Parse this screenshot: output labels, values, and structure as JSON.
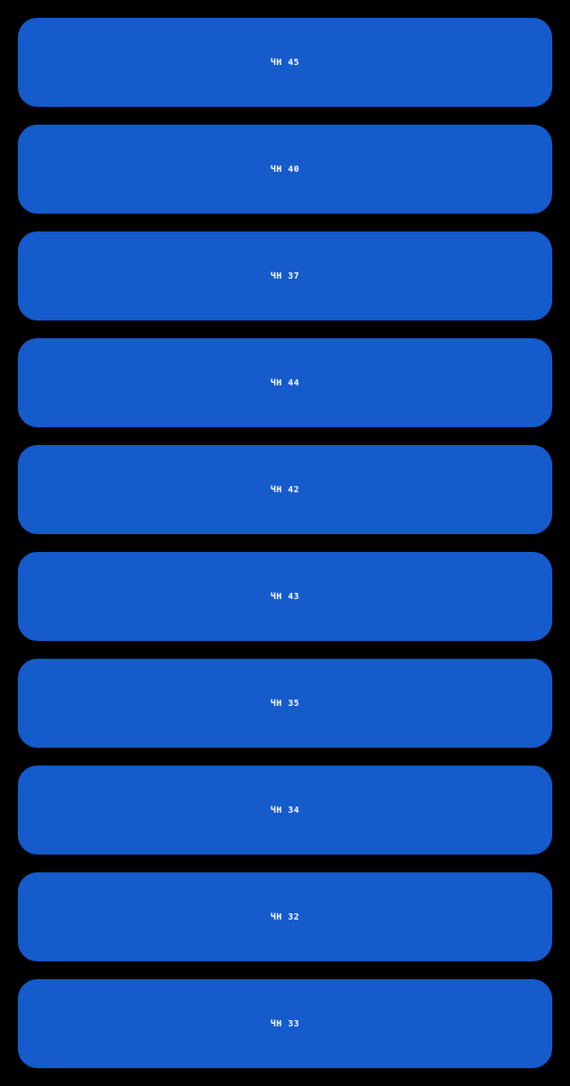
{
  "colors": {
    "background": "#000000",
    "tile": "#155bcb",
    "label": "#ffffff"
  },
  "tiles": [
    {
      "label": "ЧН 45"
    },
    {
      "label": "ЧН 40"
    },
    {
      "label": "ЧН 37"
    },
    {
      "label": "ЧН 44"
    },
    {
      "label": "ЧН 42"
    },
    {
      "label": "ЧН 43"
    },
    {
      "label": "ЧН 35"
    },
    {
      "label": "ЧН 34"
    },
    {
      "label": "ЧН 32"
    },
    {
      "label": "ЧН 33"
    }
  ]
}
